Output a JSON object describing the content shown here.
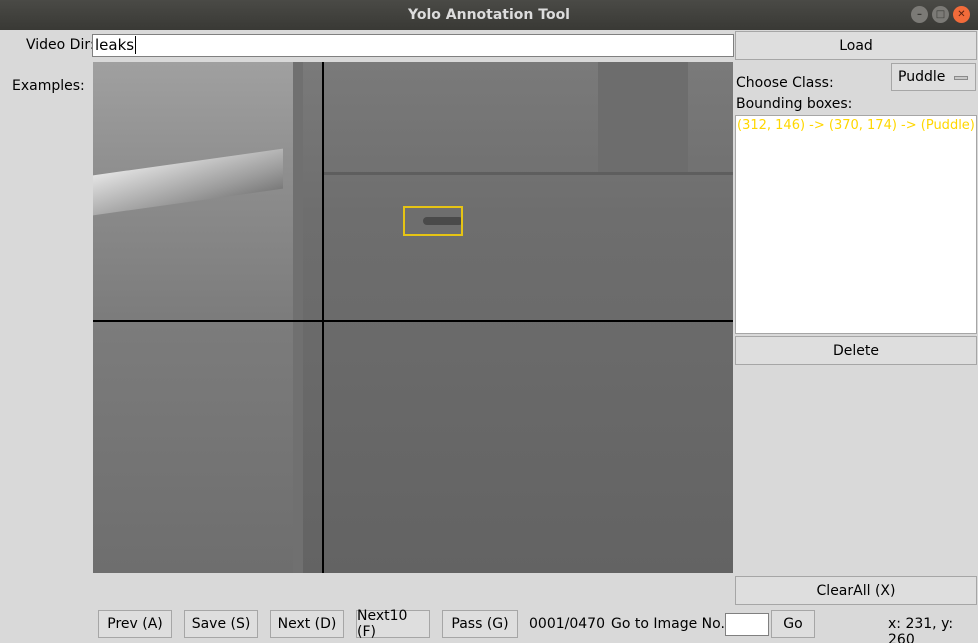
{
  "window": {
    "title": "Yolo Annotation Tool"
  },
  "top": {
    "video_dir_label": "Video Dir:",
    "video_dir_value": "leaks",
    "load_label": "Load"
  },
  "left": {
    "examples_label": "Examples:"
  },
  "right": {
    "choose_class_label": "Choose Class:",
    "selected_class": "Puddle",
    "bounding_boxes_label": "Bounding boxes:",
    "boxes": [
      "(312, 146) -> (370, 174) -> (Puddle)"
    ],
    "box_color": "#ffd700",
    "delete_label": "Delete",
    "clear_all_label": "ClearAll (X)"
  },
  "bottom": {
    "prev_label": "Prev (A)",
    "save_label": "Save (S)",
    "next_label": "Next (D)",
    "next10_label": "Next10 (F)",
    "pass_label": "Pass (G)",
    "progress": "0001/0470",
    "goto_label": "Go to Image No.",
    "goto_value": "",
    "go_label": "Go",
    "coords": "x: 231, y: 260"
  },
  "icons": {
    "minimize": "minimize-icon",
    "maximize": "maximize-icon",
    "close": "close-icon"
  }
}
